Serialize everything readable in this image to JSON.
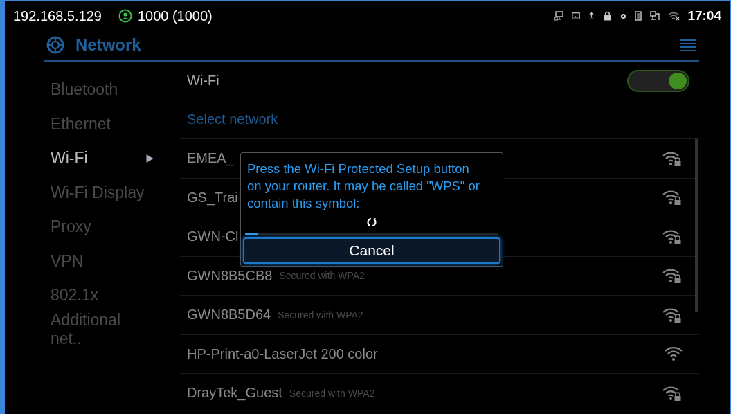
{
  "status_bar": {
    "ip": "192.168.5.129",
    "account": "1000 (1000)",
    "time": "17:04"
  },
  "header": {
    "title": "Network"
  },
  "sidebar": {
    "items": [
      {
        "label": "Bluetooth",
        "selected": false
      },
      {
        "label": "Ethernet",
        "selected": false
      },
      {
        "label": "Wi-Fi",
        "selected": true
      },
      {
        "label": "Wi-Fi Display",
        "selected": false
      },
      {
        "label": "Proxy",
        "selected": false
      },
      {
        "label": "VPN",
        "selected": false
      },
      {
        "label": "802.1x",
        "selected": false
      },
      {
        "label": "Additional net..",
        "selected": false
      }
    ]
  },
  "wifi": {
    "label": "Wi-Fi",
    "on": true
  },
  "section_title": "Select network",
  "networks": [
    {
      "name": "EMEA_",
      "secured": true
    },
    {
      "name": "GS_Trai",
      "secured": true
    },
    {
      "name": "GWN-Cl",
      "secured": true
    },
    {
      "name": "GWN8B5CB8",
      "security": "Secured with WPA2",
      "secured": true
    },
    {
      "name": "GWN8B5D64",
      "security": "Secured with WPA2",
      "secured": true
    },
    {
      "name": "HP-Print-a0-LaserJet 200 color",
      "secured": false
    },
    {
      "name": "DrayTek_Guest",
      "security": "Secured with WPA2",
      "secured": true
    }
  ],
  "dialog": {
    "message": "Press the Wi-Fi Protected Setup button on your router. It may be called \"WPS\" or contain this symbol:",
    "level": 0.05,
    "button": "Cancel"
  }
}
